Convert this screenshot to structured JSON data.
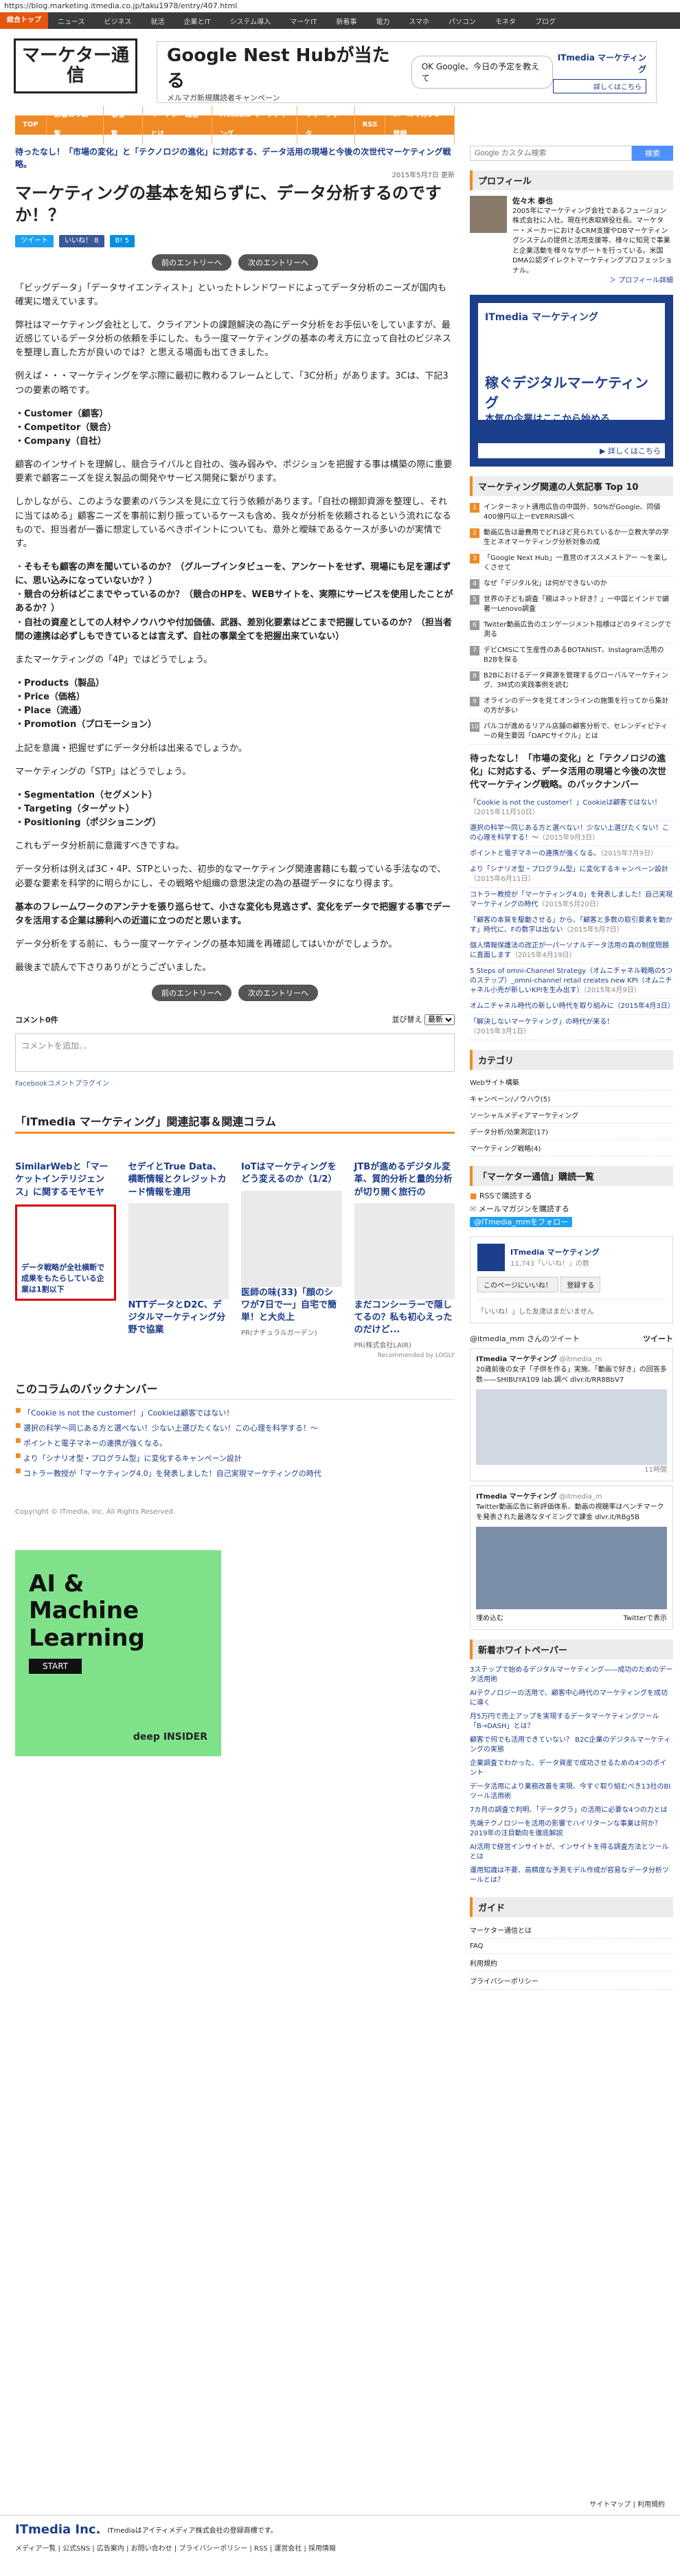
{
  "url": "https://blog.marketing.itmedia.co.jp/taku1978/entry/407.html",
  "topnav": {
    "brand": "総合トップ",
    "items": [
      "ニュース",
      "ビジネス",
      "就活",
      "企業とIT",
      "システム導入",
      "マーケIT",
      "新着事",
      "電力",
      "スマホ",
      "パソコン",
      "モネタ",
      "ブログ"
    ]
  },
  "logo_text": "マーケター通信",
  "banner": {
    "title": "Google Nest Hub",
    "title_suffix": "が当たる",
    "subtitle": "メルマガ新規購読者キャンペーン",
    "ok_text": "OK Google、今日の予定を教えて",
    "brand": "ITmedia マーケティング",
    "cta": "詳しくはこちら"
  },
  "mainnav": [
    "TOP",
    "新着コラム一覧",
    "著者一覧",
    "マーケター通信とは",
    "ITmedia マーケティング",
    "リサーチデータ",
    "RSS",
    "メールマガジン登録"
  ],
  "article": {
    "lead": "待ったなし！「市場の変化」と「テクノロジの進化」に対応する、データ活用の現場と今後の次世代マーケティング戦略。",
    "date": "2015年5月7日 更新",
    "title": "マーケティングの基本を知らずに、データ分析するのですか！？",
    "share": [
      "ツイート",
      "いいね！ 8",
      "B! 5"
    ],
    "prev": "前のエントリーへ",
    "next": "次のエントリーへ",
    "paragraphs": [
      "「ビッグデータ」「データサイエンティスト」といったトレンドワードによってデータ分析のニーズが国内も確実に増えています。",
      "弊社はマーケティング会社として、クライアントの課題解決の為にデータ分析をお手伝いをしていますが、最近感じているデータ分析の依頼を手にした、もう一度マーケティングの基本の考え方に立って自社のビジネスを整理し直した方が良いのでは？と思える場面も出てきました。",
      "例えば・・・マーケティングを学ぶ際に最初に教わるフレームとして、「3C分析」があります。3Cは、下記3つの要素の略です。",
      "顧客のインサイトを理解し、競合ライバルと自社の、強み弱みや、ポジションを把握する事は構築の際に重要要素で顧客ニーズを捉え製品の開発やサービス開発に繋がります。",
      "しかしながら、このような要素のバランスを見に立て行う依頼があります。「自社の棚卸資源を整理し、それに当てはめる」顧客ニーズを事前に割り振っているケースも含め、我々が分析を依頼されるという流れになるもので、担当者が一番に想定しているべきポイントについても、意外と曖昧であるケースが多いのが実情です。"
    ],
    "threec": [
      "Customer（顧客）",
      "Competitor（競合）",
      "Company（自社）"
    ],
    "questions": [
      "そもそも顧客の声を聞いているのか？（グループインタビューを、アンケートをせず、現場にも足を運ばずに、思い込みになっていないか？）",
      "競合の分析はどこまでやっているのか？（競合のHPを、WEBサイトを、実際にサービスを使用したことがあるか？）",
      "自社の資産としての人材やノウハウや付加価値、武器、差別化要素はどこまで把握しているのか？（担当者間の連携は必ずしもできているとは言えず、自社の事業全てを把握出来ていない）"
    ],
    "p4": "またマーケティングの「4P」ではどうでしょう。",
    "fourp": [
      "Products（製品）",
      "Price（価格）",
      "Place（流通）",
      "Promotion（プロモーション）"
    ],
    "p4b": "上記を意識・把握せずにデータ分析は出来るでしょうか。",
    "p5": "マーケティングの「STP」はどうでしょう。",
    "stp": [
      "Segmentation（セグメント）",
      "Targeting（ターゲット）",
      "Positioning（ポジショニング）"
    ],
    "p5b": "これもデータ分析前に意識すべきですね。",
    "p6": "データ分析は例えば3C・4P、STPといった、初歩的なマーケティング関連書籍にも載っている手法なので、必要な要素を科学的に明らかにし、その戦略や組織の意思決定の為の基礎データになり得ます。",
    "p7": "基本のフレームワークのアンテナを張り巡らせて、小さな変化も見逃さず、変化をデータで把握する事でデータを活用する企業は勝利への近道に立つのだと思います。",
    "p8": "データ分析をする前に、もう一度マーケティングの基本知識を再確認してはいかがでしょうか。",
    "p9": "最後まで読んで下さりありがとうございました。"
  },
  "comments": {
    "count_label": "コメント0件",
    "sort_label": "並び替え",
    "sort_value": "最新",
    "placeholder": "コメントを追加...",
    "plugin": "Facebookコメントプラグイン"
  },
  "related": {
    "heading": "「ITmedia マーケティング」関連記事＆関連コラム",
    "items": [
      {
        "title": "SimilarWebと「マーケットインテリジェンス」に関するモヤモヤ",
        "ad": "データ戦略が全社横断で成果をもたらしている企業は1割以下"
      },
      {
        "title": "セデイとTrue Data、横断情報とクレジットカード情報を連用",
        "sub": "NTTデータとD2C、デジタルマーケティング分野で協業"
      },
      {
        "title": "IoTはマーケティングをどう変えるのか（1/2）",
        "sub": "医師の味(33)「顔のシワが7日で一」自宅で簡単！と大炎上",
        "src": "PR(ナチュラルガーデン)"
      },
      {
        "title": "JTBが進めるデジタル変革、質的分析と量的分析が切り開く旅行の",
        "sub": "まだコンシーラーで隠してるの？私も初心えったのだけど...",
        "src": "PR(株式会社LAIR)"
      }
    ],
    "recommended": "Recommended by LOGLY"
  },
  "backnumber": {
    "heading": "このコラムのバックナンバー",
    "items": [
      "「Cookie is not the customer！」Cookieは顧客ではない！",
      "選択の科学～同じある方と選べない！少ない上選びたくない！この心理を科学する！～",
      "ポイントと電子マネーの連携が強くなる。",
      "より「シナリオ型・プログラム型」に変化するキャンペーン設計",
      "コトラー教授が「マーケティング4.0」を発表しました！自己実現マーケティングの時代"
    ]
  },
  "copyright": "Copyright © ITmedia, Inc. All Rights Reserved.",
  "aiad": {
    "title_lines": [
      "AI &",
      "Machine",
      "Learning"
    ],
    "cta": "START",
    "brand": "deep INSIDER"
  },
  "sidebar": {
    "search_placeholder": "Google カスタム検索",
    "search_button": "検索",
    "profile_head": "プロフィール",
    "author": "佐々木 泰也",
    "profile_text": "2005年にマーケティング会社であるフュージョン株式会社に入社。現在代表取締役社長。マーケター・メーカーにおけるCRM支援やDBマーケティングシステムの提供と活用支援等、様々に知見で事業と企業活動を様々なサポートを行っている。米国DMA公認ダイレクトマーケティングプロフェッショナル。",
    "profile_more": "＞ プロフィール詳細",
    "ad_brand": "ITmedia マーケティング",
    "ad_headline": "稼ぐデジタルマーケティング",
    "ad_sub": "本気の企業はここから始める",
    "ad_cta": "▶ 詳しくはこちら",
    "rank_head": "マーケティング関連の人気記事 Top 10",
    "rank": [
      {
        "t": "インターネット通用広告の中国外、50%がGoogle、同値400億円以上一EVERRIS調べ",
        "d": ""
      },
      {
        "t": "動画広告は最費用でどれほど見られているか一立教大学の学生とネオマーケティング分析対象の成",
        "d": ""
      },
      {
        "t": "「Google Next Hub」一直営のオススメストアー ～を楽しくさせて",
        "d": ""
      },
      {
        "t": "なぜ「デジタル化」は何ができないのか",
        "d": ""
      },
      {
        "t": "世界の子ども調査「親はネット好き？」一中国とインドで顕著一Lenovo調査",
        "d": ""
      },
      {
        "t": "Twitter動画広告のエンゲージメント指標はどのタイミングで測る",
        "d": ""
      },
      {
        "t": "デビCMSにて生産性のあるBOTANIST、Instagram活用のB2Bを探る",
        "d": ""
      },
      {
        "t": "B2Bにおけるデータ資源を管理するグローバルマーケティング、3M式の実践事例を読む",
        "d": ""
      },
      {
        "t": "オラインのデータを見てオンラインの施策を行ってから集計の方が多い",
        "d": ""
      },
      {
        "t": "パルコが進めるリアル店舗の顧客分析で、セレンディピティーの発生要因「DAPCサイクル」とは",
        "d": ""
      }
    ],
    "sub_head": "待ったなし！「市場の変化」と「テクノロジの進化」に対応する、データ活用の現場と今後の次世代マーケティング戦略。のバックナンバー",
    "sub_items": [
      {
        "t": "「Cookie is not the customer！」Cookieは顧客ではない！",
        "d": "（2015年11月10日）"
      },
      {
        "t": "選択の科学～同じある方と選べない！少ない上選びたくない！この心理を科学する！～",
        "d": "（2015年9月3日）"
      },
      {
        "t": "ポイントと電子マネーの連携が強くなる。",
        "d": "（2015年7月9日）"
      },
      {
        "t": "より「シナリオ型・プログラム型」に変化するキャンペーン設計",
        "d": "（2015年6月11日）"
      },
      {
        "t": "コトラー教授が「マーケティング4.0」を発表しました！自己実現マーケティングの時代",
        "d": "（2015年5月20日）"
      },
      {
        "t": "「顧客の本質を駆動させる」から、「顧客と多数の取引要素を動かす」時代に、Fの数字は出ない",
        "d": "（2015年5月7日）"
      },
      {
        "t": "個人情報保護法の改正が一パーソナルデータ活用の真の制度問題に直面します",
        "d": "（2015年4月19日）"
      },
      {
        "t": "5 Steps of omni-Channel Strategy（オムニチャネル戦略の5つのステップ）_omni-channel retail creates new KPI（オムニチャネル小売が新しいKPIを生み出す）",
        "d": "（2015年4月9日）"
      },
      {
        "t": "オムニチャネル時代の新しい時代を取り組みに（2015年4月3日）",
        "d": ""
      },
      {
        "t": "「解決しないマーケティング」の時代が来る！",
        "d": "（2015年3月1日）"
      }
    ],
    "cat_head": "カテゴリ",
    "cats": [
      "Webサイト構築",
      "キャンペーン/ノウハウ(5)",
      "ソーシャルメディアマーケティング",
      "データ分析/効果測定(17)",
      "マーケティング戦略(4)"
    ],
    "follow_head": "「マーケター通信」購読一覧",
    "follow": [
      "RSSで購読する",
      "メールマガジンを購読する",
      "@ITmedia_mmをフォロー"
    ],
    "fb_page": "ITmedia マーケティング",
    "fb_likes": "11,743「いいね！」の数",
    "fb_share": "このページにいいね！",
    "fb_register": "登録する",
    "fb_friends": "「いいね！」した友達はまだいません",
    "tw_handle": "@itmedia_mm さんのツイート",
    "tw_title": "ツイート",
    "tw1_user": "ITmedia マーケティング",
    "tw1_handle": "@itmedia_m",
    "tw1_text": "20歳前後の女子「子供を作る」実施、「動画で好き」の回答多数——SHIBUYA109 lab.調べ dlvr.it/RR8BbV7",
    "tw1_time": "11時間",
    "tw2_user": "ITmedia マーケティング",
    "tw2_handle": "@itmedia_m",
    "tw2_text": "Twitter動画広告に新評価体系、動画の視聴率はベンチマークを発表された最適なタイミングで課金 dlvr.it/RBg5B",
    "tw_footer": "埋め込む",
    "tw_view": "Twitterで表示",
    "wp_head": "新着ホワイトペーパー",
    "wp_items": [
      "3ステップで始めるデジタルマーケティング——成功のためのデータ活用術",
      "AIテクノロジーの活用で、顧客中心時代のマーケティングを成功に導く",
      "月5万円で売上アップを実現するデータマーケティングツール「B→DASH」とは？",
      "顧客で何でも活用できていない？ B2C企業のデジタルマーケティングの実態",
      "企業調査でわかった、データ資産で成功させるための4つのポイント",
      "データ活用により業務改善を実現、今すぐ取り組むべき13社のBIツール活用術",
      "7カ月の調査で判明、「データグラ」の活用に必要な4つの力とは",
      "先端テクノロジーを活用の影響でハイリターンな事業は何か？ 2019年の注目動向を徹底解説",
      "AI活用で経営インサイトが、インサイトを得る調査方法とツールとは",
      "運用知識は不要、高精度な予測モデル作成が容易なデータ分析ツールとは？"
    ],
    "guide_head": "ガイド",
    "guide": [
      "マーケター通信とは",
      "FAQ",
      "利用規約",
      "プライバシーポリシー"
    ]
  },
  "sitemap": [
    "サイトマップ",
    "利用規約"
  ],
  "footer": {
    "brand": "ITmedia Inc.",
    "tag": "ITmediaはアイティメディア株式会社の登録商標です。",
    "links": "メディア一覧 | 公式SNS | 広告案内 | お問い合わせ | プライバシーポリシー | RSS | 運営会社 | 採用情報"
  }
}
